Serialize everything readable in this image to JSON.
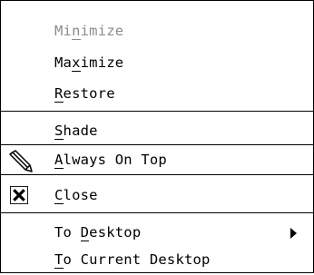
{
  "menu": {
    "minimize": {
      "pre": "Mi",
      "mn": "n",
      "post": "imize"
    },
    "maximize": {
      "pre": "Ma",
      "mn": "x",
      "post": "imize"
    },
    "restore": {
      "pre": "",
      "mn": "R",
      "post": "estore"
    },
    "shade": {
      "pre": "",
      "mn": "S",
      "post": "hade"
    },
    "always_on_top": {
      "pre": "",
      "mn": "A",
      "post": "lways On Top"
    },
    "close": {
      "pre": "",
      "mn": "C",
      "post": "lose"
    },
    "to_desktop": {
      "pre": "To ",
      "mn": "D",
      "post": "esktop"
    },
    "to_current_desktop": {
      "pre": "",
      "mn": "T",
      "post": "o Current Desktop"
    }
  },
  "icons": {
    "always_on_top": "pencil-icon",
    "close": "close-box-icon",
    "to_desktop": "submenu-arrow-icon"
  },
  "colors": {
    "disabled_text": "#8c8c8c",
    "text": "#000000",
    "background": "#ffffff"
  }
}
